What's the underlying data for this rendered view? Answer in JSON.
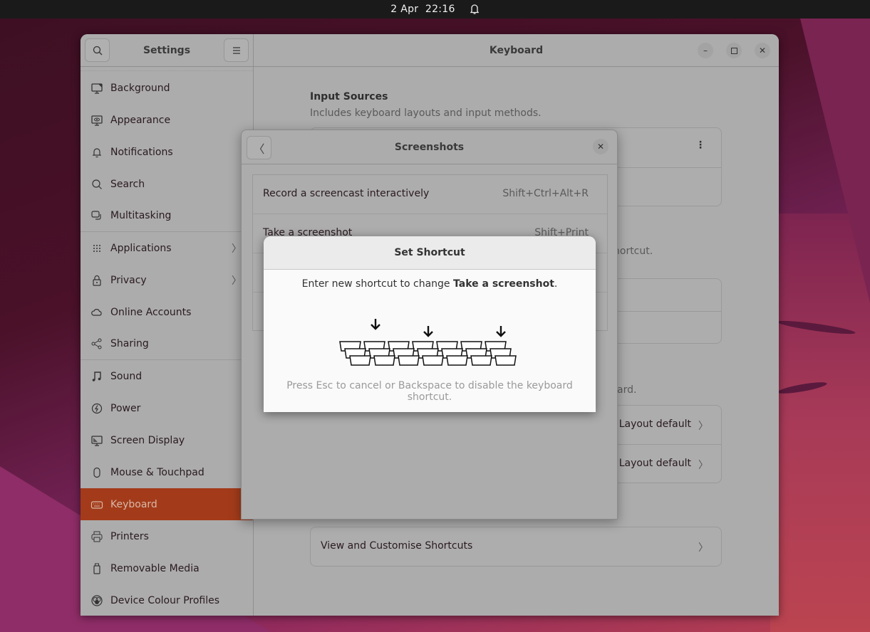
{
  "topbar": {
    "date": "2 Apr",
    "time": "22:16"
  },
  "settings": {
    "sidebar_title": "Settings",
    "sidebar_items": [
      {
        "label": "Background",
        "icon": "background-icon"
      },
      {
        "label": "Appearance",
        "icon": "appearance-icon"
      },
      {
        "label": "Notifications",
        "icon": "bell-icon"
      },
      {
        "label": "Search",
        "icon": "search-icon"
      },
      {
        "label": "Multitasking",
        "icon": "multitasking-icon"
      },
      {
        "label": "Applications",
        "icon": "apps-grid-icon",
        "has_submenu": true
      },
      {
        "label": "Privacy",
        "icon": "lock-icon",
        "has_submenu": true
      },
      {
        "label": "Online Accounts",
        "icon": "cloud-icon"
      },
      {
        "label": "Sharing",
        "icon": "share-icon"
      },
      {
        "label": "Sound",
        "icon": "music-note-icon"
      },
      {
        "label": "Power",
        "icon": "power-icon"
      },
      {
        "label": "Screen Display",
        "icon": "display-icon"
      },
      {
        "label": "Mouse & Touchpad",
        "icon": "mouse-icon"
      },
      {
        "label": "Keyboard",
        "icon": "keyboard-icon",
        "active": true
      },
      {
        "label": "Printers",
        "icon": "printer-icon"
      },
      {
        "label": "Removable Media",
        "icon": "usb-icon"
      },
      {
        "label": "Device Colour Profiles",
        "icon": "colour-profile-icon"
      }
    ],
    "main_title": "Keyboard",
    "input_sources": {
      "title": "Input Sources",
      "subtitle": "Includes keyboard layouts and input methods."
    },
    "peek_text_1": "hortcut.",
    "peek_text_2": "ard.",
    "layout_rows": [
      "Layout default",
      "Layout default"
    ],
    "view_shortcuts_label": "View and Customise Shortcuts",
    "accent_color": "#a33b1a"
  },
  "screenshots_dialog": {
    "title": "Screenshots",
    "rows": [
      {
        "label": "Record a screencast interactively",
        "accel": "Shift+Ctrl+Alt+R"
      },
      {
        "label": "Take a screenshot",
        "accel": "Shift+Print"
      },
      {
        "label": "",
        "accel": ""
      },
      {
        "label": "",
        "accel": ""
      }
    ]
  },
  "set_shortcut_dialog": {
    "title": "Set Shortcut",
    "message_prefix": "Enter new shortcut to change ",
    "message_target": "Take a screenshot",
    "message_suffix": ".",
    "hint": "Press Esc to cancel or Backspace to disable the keyboard shortcut."
  }
}
